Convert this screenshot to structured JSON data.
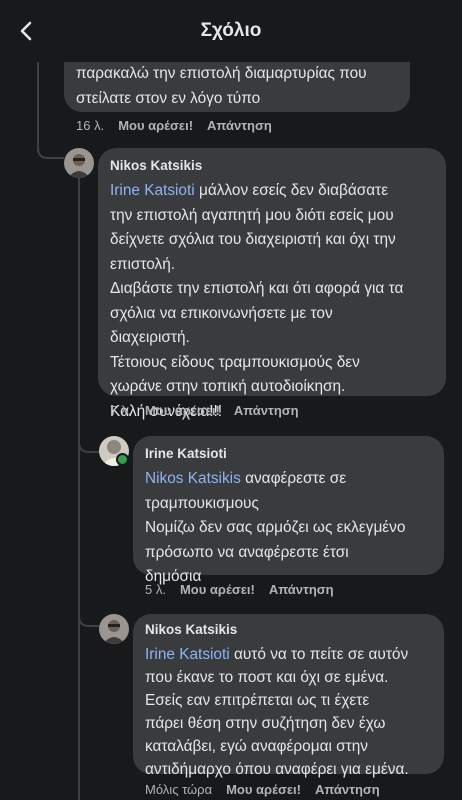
{
  "header": {
    "title": "Σχόλιο"
  },
  "comments": [
    {
      "lines": [
        "παρακαλώ  την επιστολή  διαμαρτυρίας που",
        "στείλατε στον εν λόγο τύπο"
      ],
      "time": "16 λ.",
      "like": "Μου αρέσει!",
      "reply": "Απάντηση"
    },
    {
      "author": "Nikos Katsikis",
      "mention": "Irine Katsioti",
      "first_line_rest": " μάλλον εσείς δεν διαβάσατε",
      "lines": [
        "την επιστολή  αγαπητή μου διότι εσείς μου",
        "δείχνετε σχόλια του διαχειριστή και όχι την",
        "επιστολή.",
        "Διαβάστε την επιστολή και ότι αφορά για τα",
        "σχόλια να επικοινωνήσετε με τον",
        "διαχειριστή.",
        "Τέτοιους είδους τραμπουκισμούς δεν",
        "χωράνε στην τοπική αυτοδιοίκηση.",
        "Καλή συνέχεια!!!"
      ],
      "time": "7 λ.",
      "like": "Μου αρέσει!",
      "reply": "Απάντηση"
    },
    {
      "author": "Irine Katsioti",
      "mention": "Nikos Katsikis",
      "first_line_rest": " αναφέρεστε σε",
      "lines": [
        "τραμπουκισμους",
        "Νομίζω δεν σας αρμόζει  ως εκλεγμένο",
        "πρόσωπο να αναφέρεστε  έτσι",
        "δημόσια"
      ],
      "time": "5 λ.",
      "like": "Μου αρέσει!",
      "reply": "Απάντηση"
    },
    {
      "author": "Nikos Katsikis",
      "mention": "Irine Katsioti",
      "first_line_rest": " αυτό να το πείτε σε αυτόν",
      "lines": [
        "που έκανε το ποστ και όχι σε εμένα.",
        "Εσείς εαν επιτρέπεται ως τι έχετε",
        "πάρει θέση  στην συζήτηση δεν έχω",
        "καταλάβει, εγώ αναφέρομαι στην",
        "αντιδήμαρχο όπου αναφέρει για εμένα."
      ],
      "time": "Μόλις τώρα",
      "like": "Μου αρέσει!",
      "reply": "Απάντηση"
    }
  ]
}
